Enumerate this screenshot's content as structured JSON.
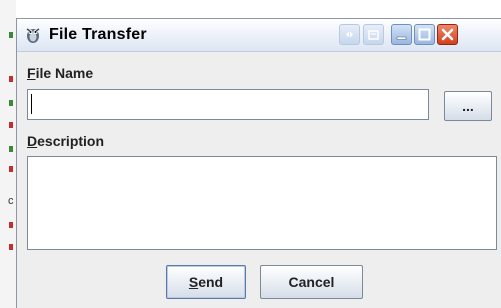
{
  "window": {
    "title": "File Transfer",
    "controls": {
      "extra1": "pin-icon",
      "extra2": "restore-alt-icon",
      "minimize": "minimize-icon",
      "maximize": "maximize-icon",
      "close": "close-icon"
    }
  },
  "form": {
    "file_name_label_mnemonic": "F",
    "file_name_label_rest": "ile Name",
    "file_name_value": "",
    "browse_label": "...",
    "description_label_mnemonic": "D",
    "description_label_rest": "escription",
    "description_value": ""
  },
  "buttons": {
    "send_mnemonic": "S",
    "send_rest": "end",
    "cancel": "Cancel"
  },
  "background": {
    "letter": "c"
  },
  "colors": {
    "close_button": "#d4411c",
    "title_button": "#9ab6e0",
    "dialog_bg": "#eeeeee"
  }
}
